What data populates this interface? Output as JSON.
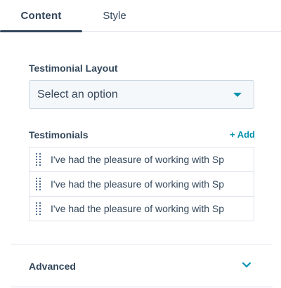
{
  "tabs": [
    {
      "label": "Content",
      "active": true
    },
    {
      "label": "Style",
      "active": false
    }
  ],
  "layout_field": {
    "label": "Testimonial Layout",
    "select_value": "Select an option"
  },
  "testimonials": {
    "label": "Testimonials",
    "add_label": "+ Add",
    "items": [
      {
        "text": "I've had the pleasure of working with Sp"
      },
      {
        "text": "I've had the pleasure of working with Sp"
      },
      {
        "text": "I've had the pleasure of working with Sp"
      }
    ]
  },
  "advanced": {
    "label": "Advanced"
  },
  "colors": {
    "text": "#33475b",
    "accent": "#0091ae",
    "border": "#dfe3eb",
    "select_bg": "#f5f8fa"
  },
  "icons": {
    "select_caret": "caret-down-icon",
    "drag": "drag-handle-icon",
    "advanced_toggle": "chevron-down-icon"
  }
}
